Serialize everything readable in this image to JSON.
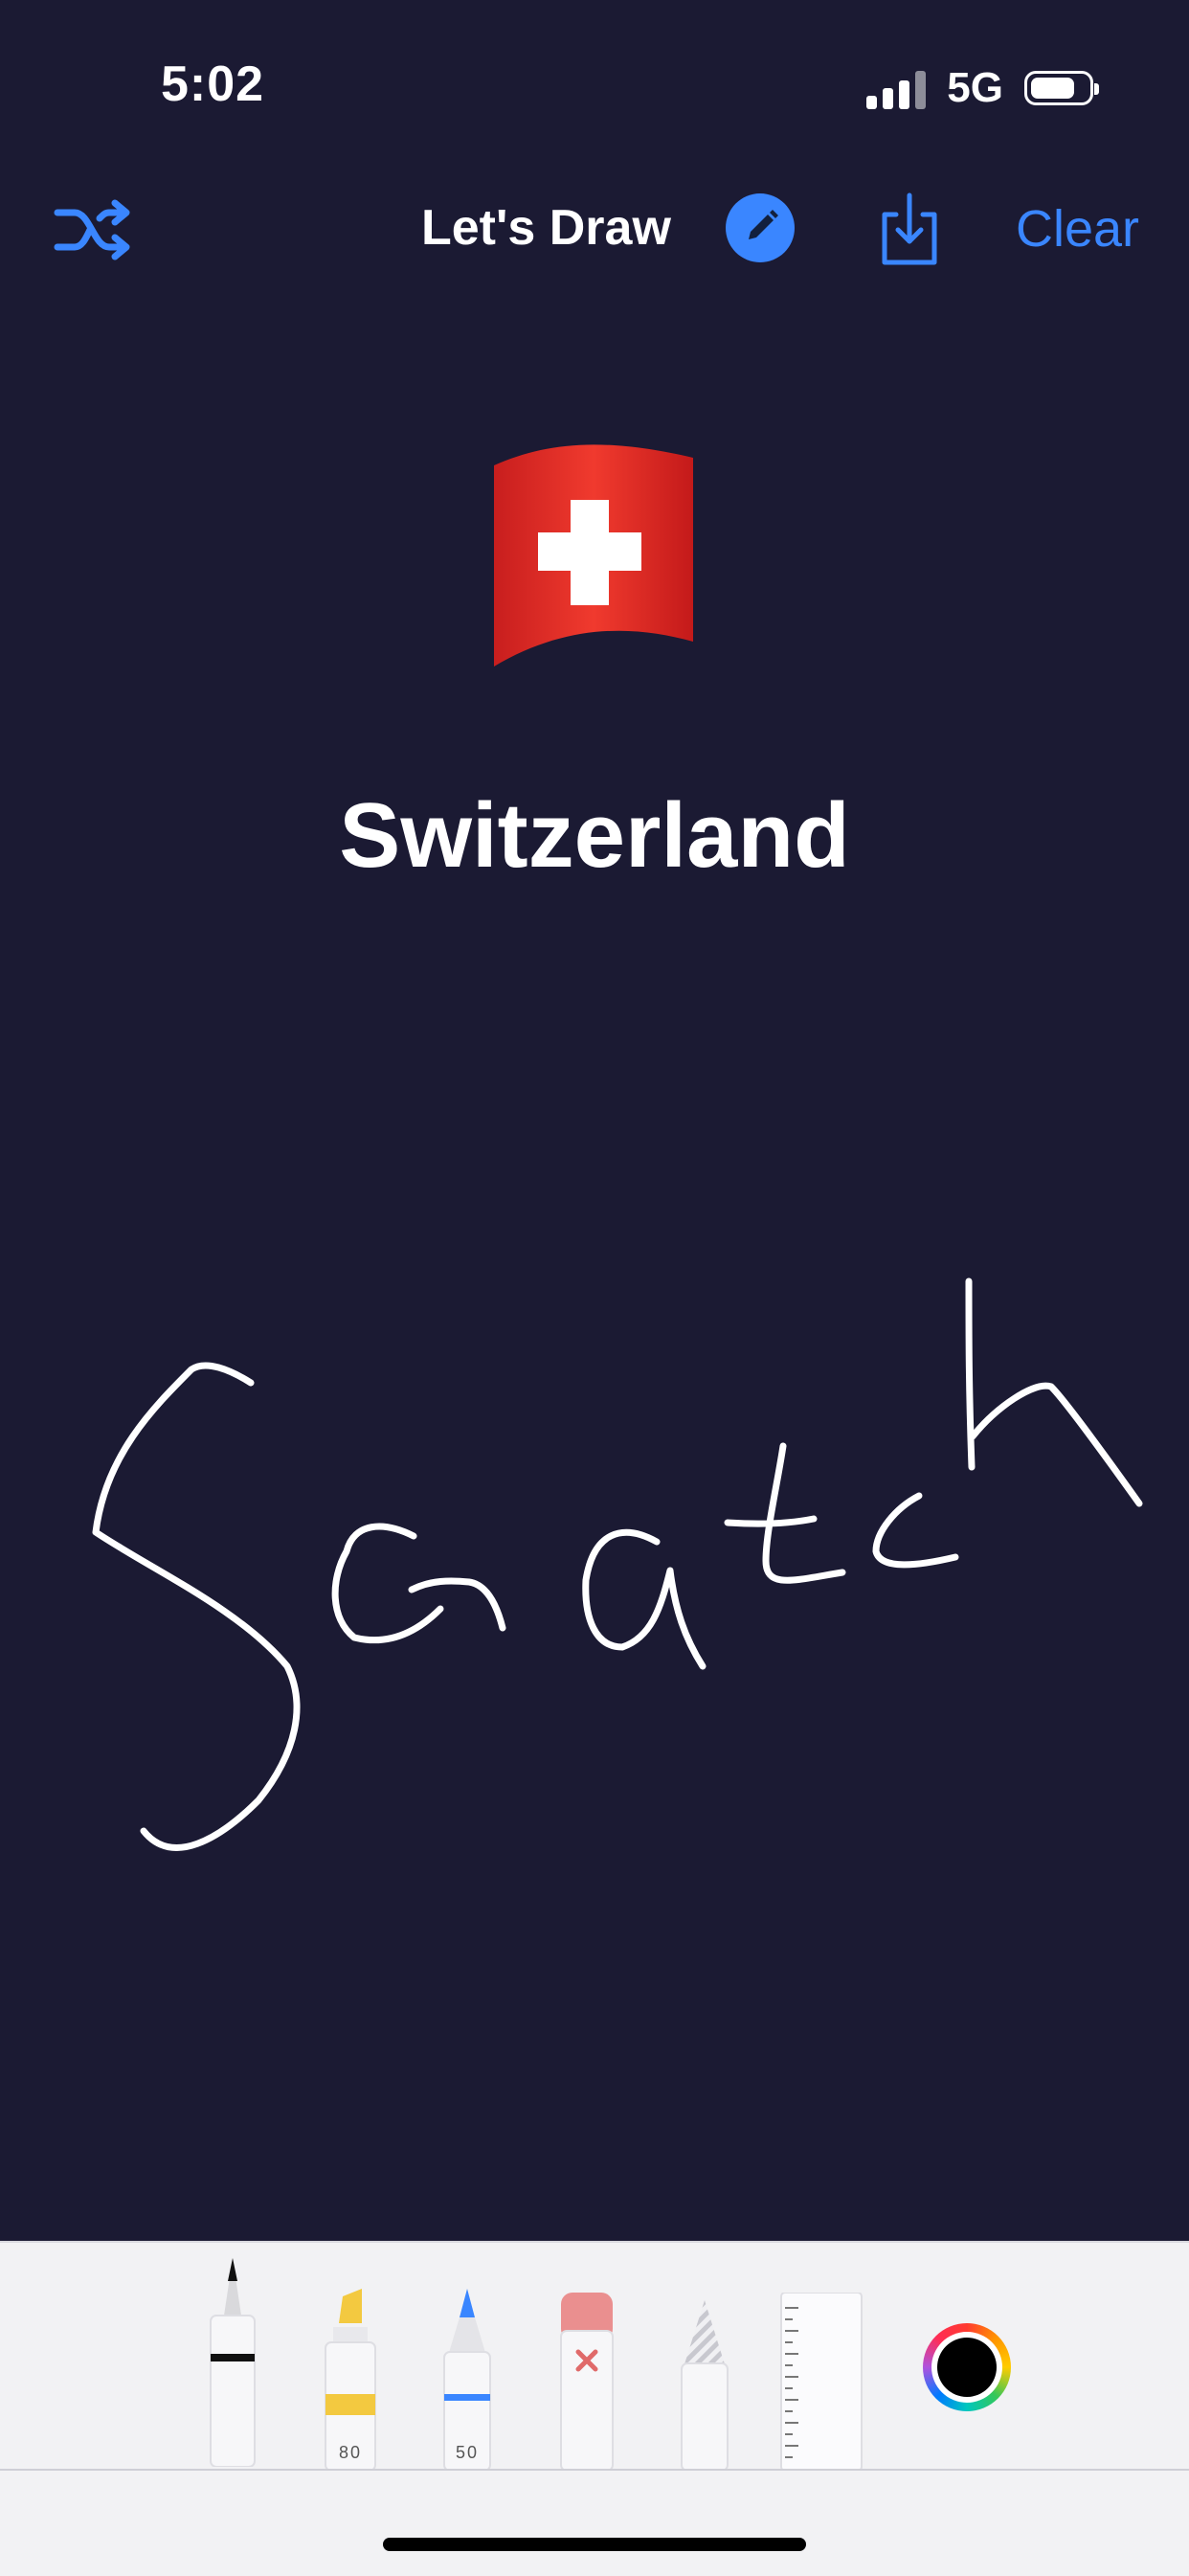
{
  "status": {
    "time": "5:02",
    "network": "5G",
    "battery_level_pct": 80
  },
  "nav": {
    "title": "Let's Draw",
    "clear_label": "Clear"
  },
  "icons": {
    "shuffle": "shuffle-icon",
    "edit": "pencil-icon",
    "download": "download-icon"
  },
  "colors": {
    "background": "#1b1a33",
    "accent": "#3a86ff",
    "stroke": "#ffffff",
    "toolbar": "#f2f2f4"
  },
  "subject": {
    "country": "Switzerland"
  },
  "canvas": {
    "handwritten_text": "Scratch"
  },
  "tools": {
    "pen": {
      "name": "pen"
    },
    "marker": {
      "name": "marker",
      "width_label": "80"
    },
    "pencil": {
      "name": "pencil",
      "width_label": "50"
    },
    "eraser": {
      "name": "eraser"
    },
    "lasso": {
      "name": "lasso"
    },
    "ruler": {
      "name": "ruler"
    },
    "selected_color": "#000000"
  }
}
